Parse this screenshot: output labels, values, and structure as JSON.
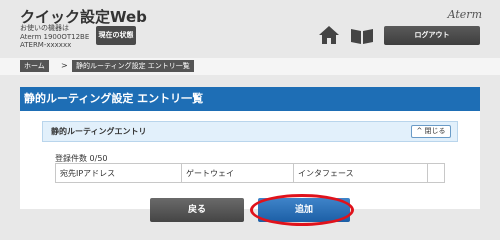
{
  "header": {
    "app_title": "クイック設定Web",
    "device_line1": "お使いの機器は",
    "device_line2": "Aterm 1900OT12BE",
    "device_line3": "ATERM-xxxxxx",
    "status_button": "現在の状態",
    "brand": "Aterm",
    "logout_button": "ログアウト",
    "icons": [
      "home-icon",
      "book-icon"
    ]
  },
  "breadcrumb": {
    "home": "ホーム",
    "separator": ">",
    "current": "静的ルーティング設定 エントリ一覧"
  },
  "page": {
    "title": "静的ルーティング設定 エントリ一覧"
  },
  "section": {
    "title": "静的ルーティングエントリ",
    "close_button": "閉じる",
    "count_text": "登録件数 0/50"
  },
  "table": {
    "columns": [
      "宛先IPアドレス",
      "ゲートウェイ",
      "インタフェース",
      ""
    ]
  },
  "actions": {
    "back_button": "戻る",
    "add_button": "追加"
  },
  "colors": {
    "title_bar": "#1e6eb5",
    "add_button": "#1c5fa6",
    "highlight": "#e0121b"
  }
}
